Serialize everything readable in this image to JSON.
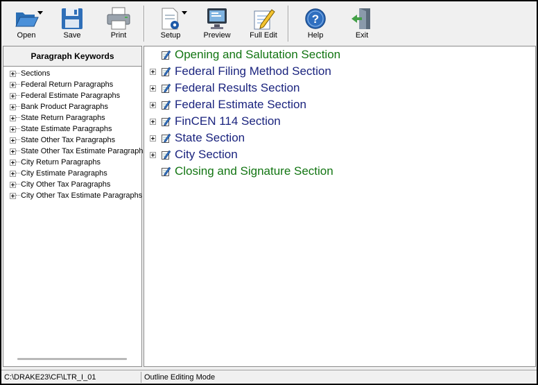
{
  "toolbar": {
    "buttons": [
      {
        "id": "open",
        "label": "Open",
        "icon": "folder-open-icon"
      },
      {
        "id": "save",
        "label": "Save",
        "icon": "floppy-disk-icon"
      },
      {
        "id": "print",
        "label": "Print",
        "icon": "printer-icon"
      },
      {
        "id": "setup",
        "label": "Setup",
        "icon": "document-gear-icon"
      },
      {
        "id": "preview",
        "label": "Preview",
        "icon": "monitor-preview-icon"
      },
      {
        "id": "full_edit",
        "label": "Full Edit",
        "icon": "pencil-notepad-icon"
      },
      {
        "id": "help",
        "label": "Help",
        "icon": "question-circle-icon"
      },
      {
        "id": "exit",
        "label": "Exit",
        "icon": "exit-door-icon"
      }
    ]
  },
  "keywords": {
    "title": "Paragraph Keywords",
    "items": [
      "Sections",
      "Federal Return Paragraphs",
      "Federal Estimate Paragraphs",
      "Bank Product Paragraphs",
      "State Return Paragraphs",
      "State Estimate Paragraphs",
      "State Other Tax Paragraphs",
      "State Other Tax Estimate Paragraphs",
      "City Return Paragraphs",
      "City Estimate Paragraphs",
      "City Other Tax Paragraphs",
      "City Other Tax Estimate Paragraphs"
    ]
  },
  "outline": {
    "sections": [
      {
        "label": "Opening and Salutation Section",
        "color": "#127512",
        "expandable": false
      },
      {
        "label": "Federal Filing Method Section",
        "color": "#1a237e",
        "expandable": true
      },
      {
        "label": "Federal Results Section",
        "color": "#1a237e",
        "expandable": true
      },
      {
        "label": "Federal Estimate Section",
        "color": "#1a237e",
        "expandable": true
      },
      {
        "label": "FinCEN 114 Section",
        "color": "#1a237e",
        "expandable": true
      },
      {
        "label": "State Section",
        "color": "#1a237e",
        "expandable": true
      },
      {
        "label": "City Section",
        "color": "#1a237e",
        "expandable": true
      },
      {
        "label": "Closing and Signature Section",
        "color": "#127512",
        "expandable": false
      }
    ]
  },
  "status": {
    "path": "C:\\DRAKE23\\CF\\LTR_I_01",
    "mode": "Outline Editing Mode"
  }
}
